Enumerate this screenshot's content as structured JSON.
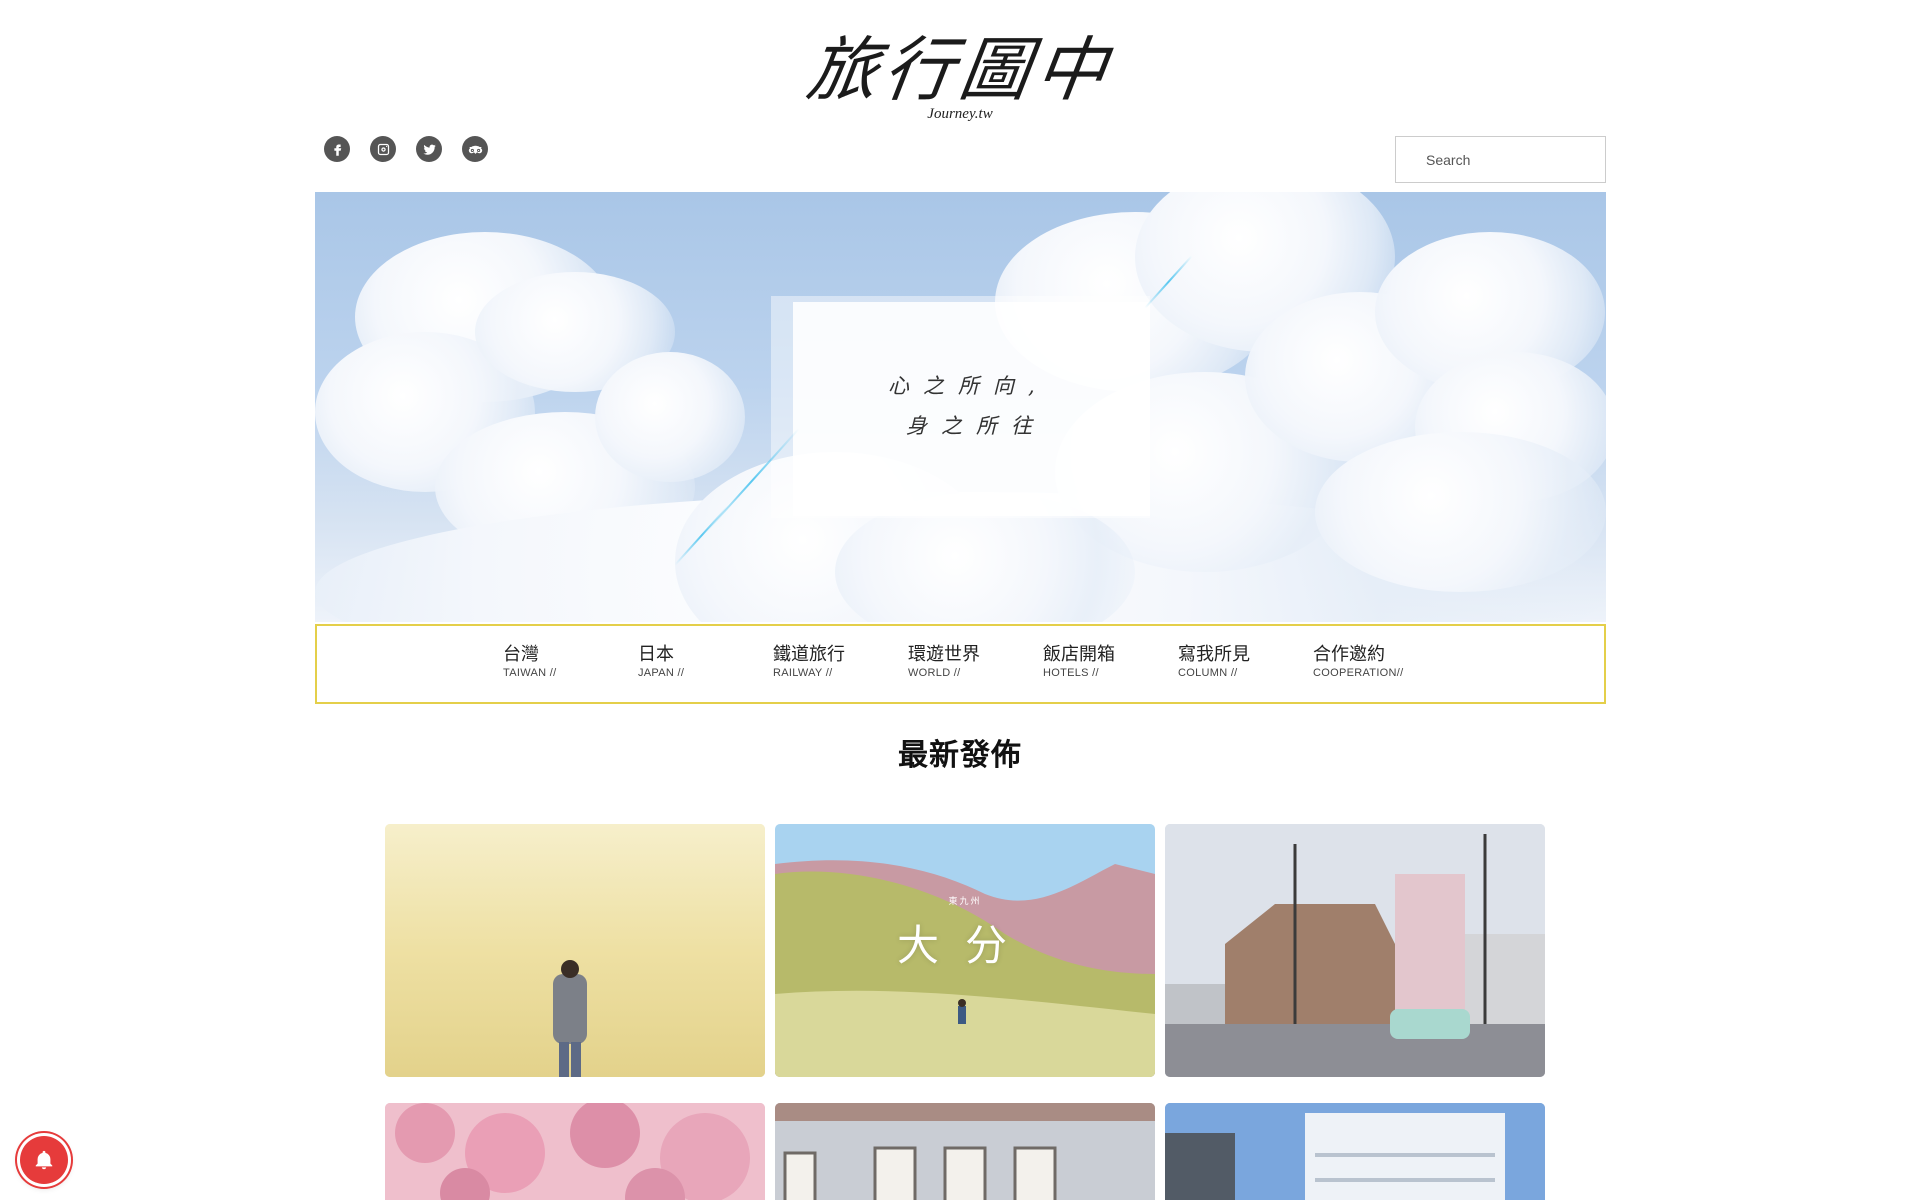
{
  "brand": {
    "logo_text": "旅行圖中",
    "logo_sub": "Journey.tw"
  },
  "social": [
    {
      "name": "facebook-icon"
    },
    {
      "name": "instagram-icon"
    },
    {
      "name": "twitter-icon"
    },
    {
      "name": "tripadvisor-icon"
    }
  ],
  "search": {
    "placeholder": "Search"
  },
  "hero": {
    "line1": "心之所向,",
    "line2": "身之所往"
  },
  "nav": {
    "items": [
      {
        "zh": "台灣",
        "en": "TAIWAN //"
      },
      {
        "zh": "日本",
        "en": "JAPAN //"
      },
      {
        "zh": "鐵道旅行",
        "en": "RAILWAY //"
      },
      {
        "zh": "環遊世界",
        "en": "WORLD //"
      },
      {
        "zh": "飯店開箱",
        "en": "HOTELS //"
      },
      {
        "zh": "寫我所見",
        "en": "COLUMN //"
      },
      {
        "zh": "合作邀約",
        "en": "COOPERATION//"
      }
    ]
  },
  "latest": {
    "title": "最新發佈",
    "thumb2_title": "大分",
    "thumb2_sub": "東九州"
  },
  "colors": {
    "nav_border": "#e4cf4a",
    "bell": "#e63b3b"
  }
}
